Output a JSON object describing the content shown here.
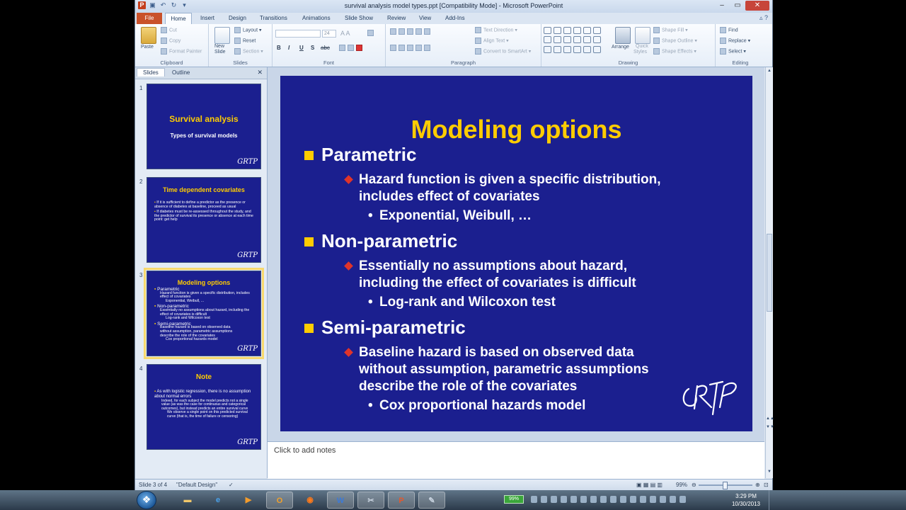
{
  "window": {
    "title": "survival analysis model types.ppt [Compatibility Mode] - Microsoft PowerPoint"
  },
  "ribbon": {
    "tabs": [
      "File",
      "Home",
      "Insert",
      "Design",
      "Transitions",
      "Animations",
      "Slide Show",
      "Review",
      "View",
      "Add-Ins"
    ],
    "clipboard": {
      "paste": "Paste",
      "cut": "Cut",
      "copy": "Copy",
      "format_painter": "Format Painter",
      "label": "Clipboard"
    },
    "slides": {
      "new_slide": "New",
      "new_slide2": "Slide",
      "layout": "Layout",
      "reset": "Reset",
      "section": "Section",
      "label": "Slides"
    },
    "font": {
      "size": "24",
      "bold": "B",
      "italic": "I",
      "underline": "U",
      "strike": "S",
      "shadow": "abc",
      "label": "Font"
    },
    "paragraph": {
      "text_direction": "Text Direction",
      "align_text": "Align Text",
      "convert_smartart": "Convert to SmartArt",
      "label": "Paragraph"
    },
    "drawing": {
      "arrange": "Arrange",
      "quick_styles": "Quick",
      "quick_styles2": "Styles",
      "shape_fill": "Shape Fill",
      "shape_outline": "Shape Outline",
      "shape_effects": "Shape Effects",
      "label": "Drawing"
    },
    "editing": {
      "find": "Find",
      "replace": "Replace",
      "select": "Select",
      "label": "Editing"
    }
  },
  "panel": {
    "tabs": [
      "Slides",
      "Outline"
    ],
    "close": "✕",
    "thumbs": [
      {
        "num": "1",
        "title": "Survival analysis",
        "subtitle": "Types of survival models"
      },
      {
        "num": "2",
        "title": "Time dependent covariates",
        "bullets": [
          "If it is sufficient to define a predictor as the presence or absence of diabetes at baseline, proceed as usual",
          "If diabetes must be re-assessed throughout the study, and the predictor of survival its presence or absence at each time point: get help"
        ]
      },
      {
        "num": "3",
        "title": "Modeling options",
        "lines": [
          "Parametric",
          "Hazard function is given a specific distribution, includes effect of covariates",
          "Exponential, Weibull, ...",
          "Non-parametric",
          "Essentially no assumptions about hazard, including the effect of covariates is difficult",
          "Log-rank and Wilcoxon test",
          "Semi-parametric",
          "Baseline hazard is based on observed data without assumption, parametric assumptions describe the role of the covariates",
          "Cox proportional hazards model"
        ]
      },
      {
        "num": "4",
        "title": "Note",
        "lines": [
          "As with logistic regression, there is no assumption about normal errors",
          "Indeed, for each subject the model predicts not a single value (as was the case for continuous and categorical outcomes), but instead predicts an entire survival curve",
          "We observe a single point on this predicted survival curve (that is, the time of failure or censoring)"
        ]
      }
    ],
    "signature": "GRTP"
  },
  "slide": {
    "title": "Modeling options",
    "sections": [
      {
        "heading": "Parametric",
        "sub": [
          "Hazard function is given a specific distribution,",
          "includes effect of covariates"
        ],
        "detail": "Exponential, Weibull, …"
      },
      {
        "heading": "Non-parametric",
        "sub": [
          "Essentially no assumptions about hazard,",
          "including the effect of covariates is difficult"
        ],
        "detail": "Log-rank and Wilcoxon test"
      },
      {
        "heading": "Semi-parametric",
        "sub": [
          "Baseline hazard is based on observed data",
          "without assumption, parametric assumptions",
          "describe the role of the covariates"
        ],
        "detail": "Cox proportional hazards model"
      }
    ],
    "colors": {
      "background": "#1b1f8f",
      "title": "#ffcc00",
      "bullet1": "#ffcc00",
      "bullet2": "#e0342a"
    }
  },
  "notes": {
    "placeholder": "Click to add notes"
  },
  "status": {
    "slide": "Slide 3 of 4",
    "theme": "\"Default Design\"",
    "zoom": "99%"
  },
  "taskbar": {
    "battery": "99%",
    "time": "3:29 PM",
    "date": "10/30/2013"
  }
}
